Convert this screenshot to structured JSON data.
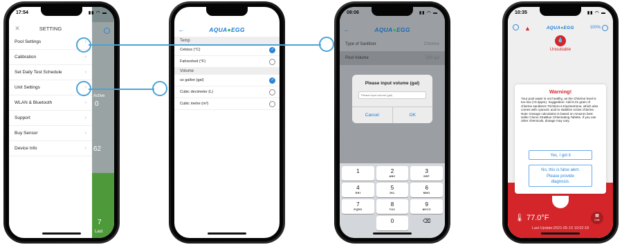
{
  "phone1": {
    "time": "17:54",
    "header_title": "SETTING",
    "close_glyph": "✕",
    "menu_items": [
      {
        "label": "Pool Settings"
      },
      {
        "label": "Calibration"
      },
      {
        "label": "Set Daily Test Schedule"
      },
      {
        "label": "Unit Settings"
      },
      {
        "label": "WLAN & Bluetooth"
      },
      {
        "label": "Support"
      },
      {
        "label": "Buy Sensor"
      },
      {
        "label": "Device Info"
      }
    ],
    "chevron": "›",
    "behind_text_active": "Active",
    "behind_value_1": "0",
    "behind_value_2": "62",
    "behind_temp": "7",
    "behind_last": "Last"
  },
  "phone2": {
    "logo_main": "AQUA",
    "logo_accent": "EGG",
    "back_glyph": "←",
    "sections": [
      {
        "title": "Temp",
        "options": [
          {
            "label": "Celsius (°C)",
            "selected": true
          },
          {
            "label": "Fahrenheit (°F)",
            "selected": false
          }
        ]
      },
      {
        "title": "Volume",
        "options": [
          {
            "label": "us gallon (gal)",
            "selected": true
          },
          {
            "label": "Cubic decimeter (L)",
            "selected": false
          },
          {
            "label": "Cubic metre (m³)",
            "selected": false
          }
        ]
      }
    ]
  },
  "phone3": {
    "time": "08:06",
    "logo_main": "AQUA",
    "logo_accent": "EGG",
    "back_glyph": "←",
    "rows": [
      {
        "label": "Type of Sanitizer",
        "value": "Chlorine"
      },
      {
        "label": "Pool Volume",
        "value": "500 gal"
      }
    ],
    "dialog_title": "Please input volume (gal)",
    "dialog_placeholder": "Please input volume (gal)",
    "cancel_label": "Cancel",
    "ok_label": "OK",
    "keys": [
      {
        "n": "1",
        "l": ""
      },
      {
        "n": "2",
        "l": "ABC"
      },
      {
        "n": "3",
        "l": "DEF"
      },
      {
        "n": "4",
        "l": "GHI"
      },
      {
        "n": "5",
        "l": "JKL"
      },
      {
        "n": "6",
        "l": "MNO"
      },
      {
        "n": "7",
        "l": "PQRS"
      },
      {
        "n": "8",
        "l": "TUV"
      },
      {
        "n": "9",
        "l": "WXYZ"
      },
      {
        "n": "",
        "l": ""
      },
      {
        "n": "0",
        "l": ""
      },
      {
        "n": "⌫",
        "l": ""
      }
    ]
  },
  "phone4": {
    "time": "10:35",
    "logo_main": "AQUA",
    "logo_accent": "EGG",
    "battery": "100%",
    "status_label": "Unsuitable",
    "warning_title": "Warning!",
    "warning_body": "Your pool water is not healthy, as the Chlorine level is too low (<0.3ppm). Suggestion: Add 5.01 gram of chlorine sanitizers Trichloro-s-triazinetrione, which also comes with cyanuric acid to stabilize Active chlorine. Note: Dosage calculation is based on Amazon best seller Clorox XtraBlue Chlorinating Tablets. If you use other chemicals, dosage may vary.",
    "yes_button": "Yes, I got it",
    "no_button_lines": [
      "No, this is false alert.",
      "Please provide",
      "diagnosis."
    ],
    "temperature": "77.0°F",
    "last_update": "Last Update:2021-05-10 10:02:18",
    "date_button": "Date"
  },
  "colors": {
    "accent_blue": "#2a83d8",
    "connector": "#4aa3d6",
    "alert_red": "#d4252a"
  }
}
